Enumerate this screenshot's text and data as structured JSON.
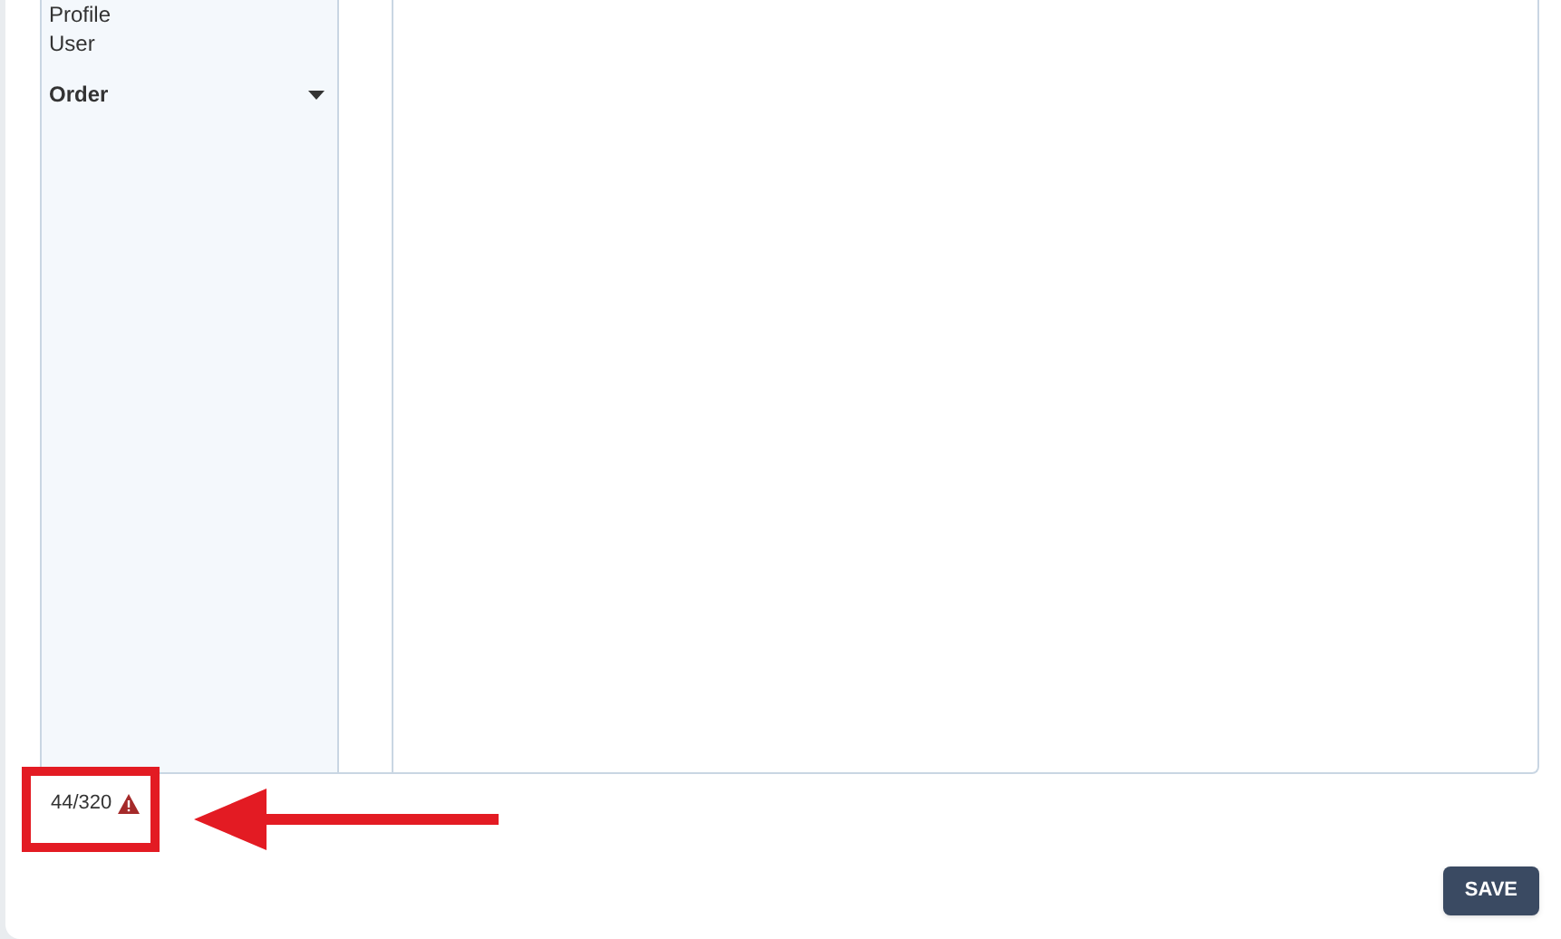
{
  "sidebar": {
    "items": [
      {
        "kind": "item",
        "label": "Profile"
      },
      {
        "kind": "item",
        "label": "User"
      },
      {
        "kind": "group",
        "label": "Order"
      }
    ]
  },
  "counter": {
    "text": "44/320",
    "warning": true
  },
  "buttons": [
    {
      "label": "SAVE"
    }
  ]
}
